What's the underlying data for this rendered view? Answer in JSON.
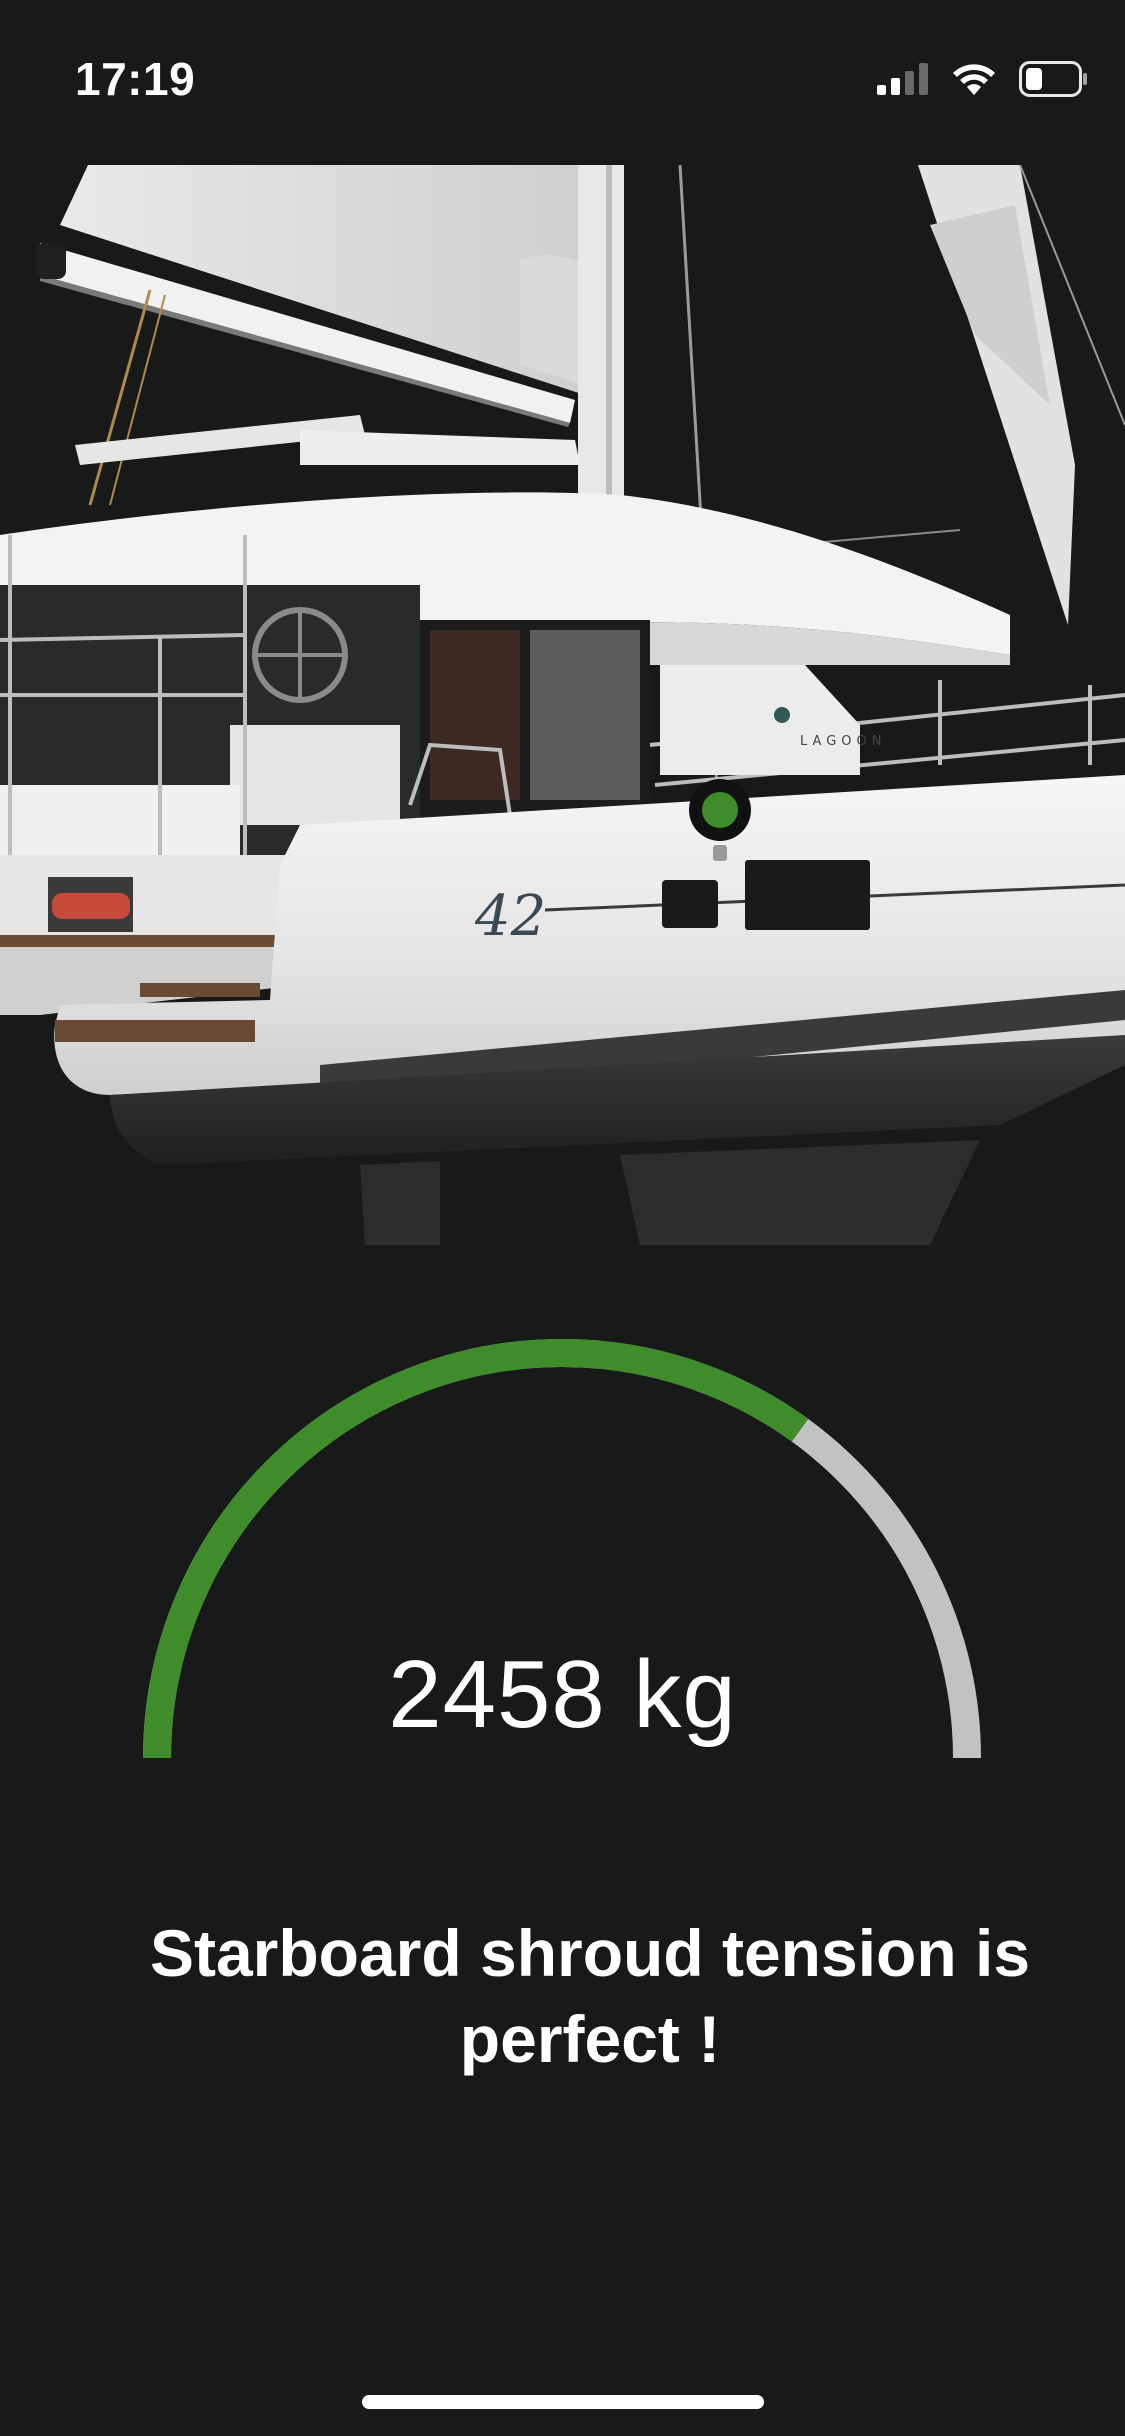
{
  "status_bar": {
    "time": "17:19",
    "icons": [
      "cellular-signal-icon",
      "wifi-icon",
      "battery-icon"
    ]
  },
  "hero": {
    "image": "catamaran-image",
    "hull_number": "42",
    "brand": "LAGOON",
    "sensor_marker_color": "#3f8d2a"
  },
  "gauge": {
    "value_text": "2458 kg",
    "fill_fraction": 0.7,
    "fill_color": "#3f8d2a",
    "track_color": "#c2c2c2"
  },
  "message": {
    "text": "Starboard shroud tension is perfect !"
  },
  "colors": {
    "background": "#181a1a",
    "accent_green": "#3f8d2a"
  }
}
